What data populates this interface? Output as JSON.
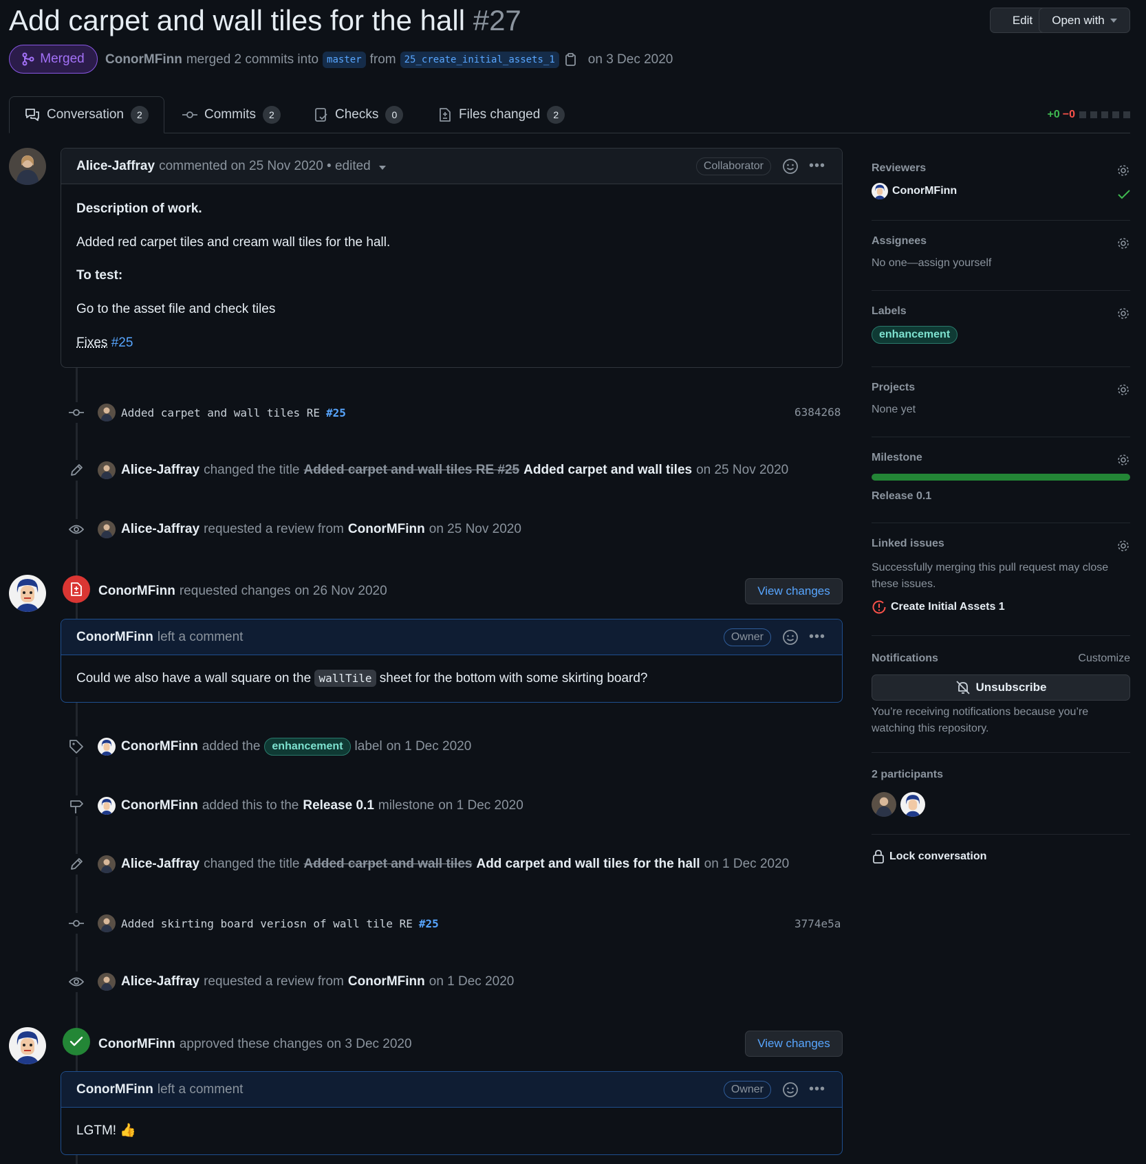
{
  "header": {
    "title": "Add carpet and wall tiles for the hall",
    "number": "#27",
    "edit_label": "Edit",
    "open_with_label": "Open with",
    "state": "Merged",
    "author": "ConorMFinn",
    "merge_text": "merged 2 commits into",
    "base_branch": "master",
    "from_text": "from",
    "head_branch": "25_create_initial_assets_1",
    "date": "on 3 Dec 2020"
  },
  "tabs": [
    {
      "label": "Conversation",
      "count": "2"
    },
    {
      "label": "Commits",
      "count": "2"
    },
    {
      "label": "Checks",
      "count": "0"
    },
    {
      "label": "Files changed",
      "count": "2"
    }
  ],
  "diffstat": {
    "added": "+0",
    "removed": "−0"
  },
  "first_comment": {
    "author": "Alice-Jaffray",
    "meta": "commented on 25 Nov 2020 • edited",
    "role": "Collaborator",
    "heading1": "Description of work.",
    "line1": "Added red carpet tiles and cream wall tiles for the hall.",
    "heading2": "To test:",
    "line2": "Go to the asset file and check tiles",
    "fixes_text": "Fixes",
    "fixes_ref": "#25"
  },
  "events": {
    "commit1": {
      "message": "Added carpet and wall tiles RE",
      "ref": "#25",
      "sha": "6384268"
    },
    "rename1": {
      "author": "Alice-Jaffray",
      "action": "changed the title",
      "old": "Added carpet and wall tiles RE #25",
      "new": "Added carpet and wall tiles",
      "date": "on 25 Nov 2020"
    },
    "review_req1": {
      "author": "Alice-Jaffray",
      "action": "requested a review from",
      "target": "ConorMFinn",
      "date": "on 25 Nov 2020"
    },
    "changes_req": {
      "author": "ConorMFinn",
      "action": "requested changes",
      "date": "on 26 Nov 2020",
      "button": "View changes"
    },
    "comment2": {
      "author": "ConorMFinn",
      "action": "left a comment",
      "role": "Owner",
      "text_before": "Could we also have a wall square on the",
      "code": "wallTile",
      "text_after": "sheet for the bottom with some skirting board?"
    },
    "label_add": {
      "author": "ConorMFinn",
      "action": "added the",
      "label": "enhancement",
      "suffix": "label",
      "date": "on 1 Dec 2020"
    },
    "milestone_add": {
      "author": "ConorMFinn",
      "action": "added this to the",
      "milestone": "Release 0.1",
      "suffix": "milestone",
      "date": "on 1 Dec 2020"
    },
    "rename2": {
      "author": "Alice-Jaffray",
      "action": "changed the title",
      "old": "Added carpet and wall tiles",
      "new": "Add carpet and wall tiles for the hall",
      "date": "on 1 Dec 2020"
    },
    "commit2": {
      "message": "Added skirting board veriosn of wall tile RE",
      "ref": "#25",
      "sha": "3774e5a"
    },
    "review_req2": {
      "author": "Alice-Jaffray",
      "action": "requested a review from",
      "target": "ConorMFinn",
      "date": "on 1 Dec 2020"
    },
    "approved": {
      "author": "ConorMFinn",
      "action": "approved these changes",
      "date": "on 3 Dec 2020",
      "button": "View changes"
    },
    "comment3": {
      "author": "ConorMFinn",
      "action": "left a comment",
      "role": "Owner",
      "text": "LGTM! 👍"
    }
  },
  "sidebar": {
    "reviewers_label": "Reviewers",
    "reviewer": "ConorMFinn",
    "assignees_label": "Assignees",
    "assignees_value": "No one—assign yourself",
    "labels_label": "Labels",
    "label": "enhancement",
    "projects_label": "Projects",
    "projects_value": "None yet",
    "milestone_label": "Milestone",
    "milestone_value": "Release 0.1",
    "milestone_progress": 1.0,
    "linked_label": "Linked issues",
    "linked_text": "Successfully merging this pull request may close these issues.",
    "linked_issue": "Create Initial Assets 1",
    "notifications_label": "Notifications",
    "customize": "Customize",
    "unsubscribe": "Unsubscribe",
    "notif_text": "You’re receiving notifications because you’re watching this repository.",
    "participants_label": "2 participants",
    "lock": "Lock conversation"
  },
  "colors": {
    "accent_blue": "#58a6ff",
    "merged_purple": "#a371f7",
    "success_green": "#3fb950",
    "danger_red": "#f85149"
  }
}
